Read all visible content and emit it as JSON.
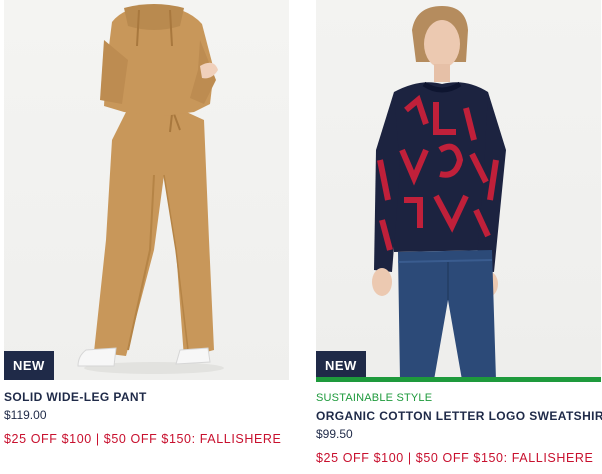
{
  "products": [
    {
      "badge": "NEW",
      "tag": "",
      "name": "SOLID WIDE-LEG PANT",
      "price": "$119.00",
      "promo": "$25 OFF $100 | $50 OFF $150: FALLISHERE",
      "image_desc_icon": "product-photo-camel-knit-set"
    },
    {
      "badge": "NEW",
      "tag": "SUSTAINABLE STYLE",
      "name": "ORGANIC COTTON LETTER LOGO SWEATSHIRT",
      "price": "$99.50",
      "promo": "$25 OFF $100 | $50 OFF $150: FALLISHERE",
      "image_desc_icon": "product-photo-logo-sweatshirt"
    }
  ],
  "colors": {
    "navy": "#1f2a48",
    "promo_red": "#c8102e",
    "sustainable_green": "#1e9a3c",
    "camel": "#c8975a"
  }
}
